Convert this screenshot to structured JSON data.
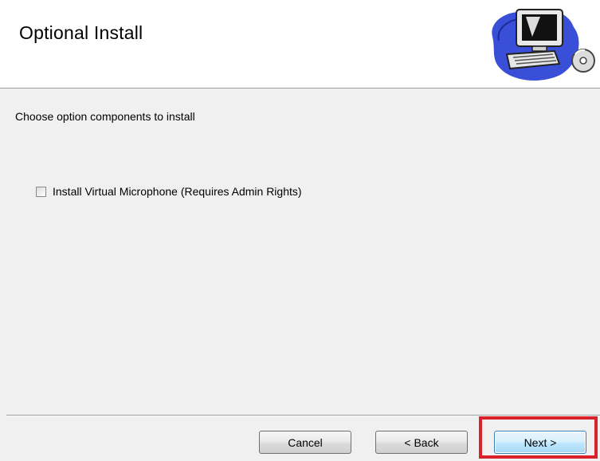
{
  "header": {
    "title": "Optional Install",
    "graphic_icon": "computer-cd-icon"
  },
  "content": {
    "subtitle": "Choose option components to install",
    "options": [
      {
        "label": "Install Virtual Microphone (Requires Admin Rights)",
        "checked": false
      }
    ]
  },
  "buttons": {
    "cancel_label": "Cancel",
    "back_label": "< Back",
    "next_label": "Next >"
  },
  "colors": {
    "highlight": "#d9222a",
    "default_button_border": "#3c7fb1",
    "background": "#f0f0f0"
  }
}
